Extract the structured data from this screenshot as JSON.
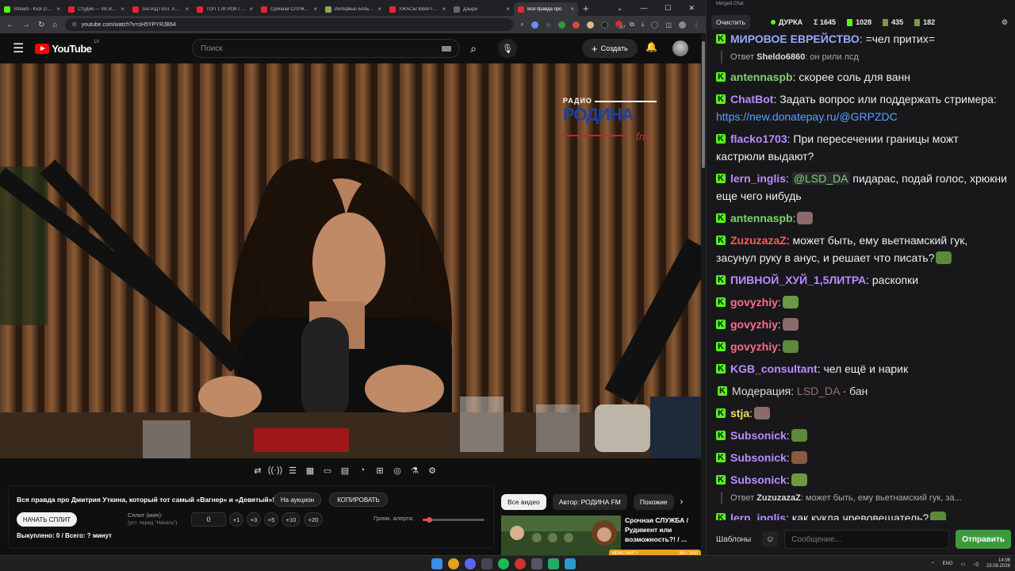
{
  "browser": {
    "tabs": [
      {
        "title": "Stream - Kick Dashboard",
        "color": "#53fc18",
        "active": false
      },
      {
        "title": "Студия — VK Видео",
        "color": "#e23",
        "active": false
      },
      {
        "title": "ЗАПАД ПАЛ. АСИМ",
        "color": "#e23",
        "active": false
      },
      {
        "title": "ТОП 1 ИГРОК ГЕНШИН",
        "color": "#e23",
        "active": false
      },
      {
        "title": "Срочная СЛУЖБА",
        "color": "#e23",
        "active": false
      },
      {
        "title": "Интервью Большое",
        "color": "#8a5",
        "active": false
      },
      {
        "title": "УЖАСЫ КВАРТИР",
        "color": "#e23",
        "active": false
      },
      {
        "title": "Дзыра",
        "color": "#666",
        "active": false
      },
      {
        "title": "Вся правда про",
        "color": "#e23",
        "active": true
      }
    ],
    "url": "youtube.com/watch?v=sH5YPYRJB64",
    "ext_badge": "357"
  },
  "youtube": {
    "logo": "YouTube",
    "country": "LV",
    "search_placeholder": "Поиск",
    "create_label": "Создать",
    "video_overlay": {
      "top": "РАДИО",
      "main": "РОДИНА",
      "fm": "fm"
    }
  },
  "panel": {
    "title": "Вся правда про Дмитрия Уткина, который тот самый «Вагнер» и «Девятый»!",
    "auction_label": "На аукцион",
    "copy_label": "КОПИРОВАТЬ",
    "start_split_label": "НАЧАТЬ СПЛИТ",
    "split_label": "Сплит (мин):",
    "split_sub": "(уст. перед \"Начать\")",
    "split_value": "0",
    "steps": [
      "+1",
      "+3",
      "+5",
      "+10",
      "+20"
    ],
    "volume_label": "Громк. алерта:",
    "volume_fraction": 0.1,
    "bought_label": "Выкуплено: 0 / Всего: ? минут"
  },
  "reco": {
    "tabs": [
      "Все видео",
      "Автор: РОДИНА FM",
      "Похожие"
    ],
    "title": "Срочная СЛУЖБА / Рудимент или возможность?! / ...",
    "meme_label": "MEME PARTY",
    "meme_count": "950 / 1500"
  },
  "chat": {
    "window_title": "Merged Chat",
    "clear_label": "Очистить",
    "streamer": "ДУРКА",
    "stats": [
      "Σ 1645",
      "1028",
      "435",
      "182"
    ],
    "messages": [
      {
        "user": "МИРОВОЕ ЕВРЕЙСТВО",
        "color": "#9aa8ff",
        "text": ": =чел притих="
      },
      {
        "reply_user": "Sheldo6860",
        "reply_text": ": он рили лсд"
      },
      {
        "user": "antennaspb",
        "color": "#7fd070",
        "text": ": скорее соль для ванн"
      },
      {
        "user": "ChatBot",
        "color": "#b98cff",
        "text": ": Задать вопрос или поддержать стримера: ",
        "link": "https://new.donatepay.ru/@GRPZDC"
      },
      {
        "user": "flacko1703",
        "color": "#b98cff",
        "text": ": При пересечении границы можт кастрюли выдают?"
      },
      {
        "user": "lern_inglis",
        "color": "#b98cff",
        "mention": "@LSD_DA",
        "text": " пидарас, подай голос, хрюкни еще чего нибудь"
      },
      {
        "user": "antennaspb",
        "color": "#7fd070",
        "text": ":",
        "emote": true
      },
      {
        "user": "ZuzuzazaZ",
        "color": "#ff5a5a",
        "text": ": может быть, ему вьетнамский гук, засунул руку в анус, и решает что писать?"
      },
      {
        "user": "ПИВНОЙ_ХУЙ_1,5ЛИТРА",
        "color": "#b98cff",
        "text": ": раскопки"
      },
      {
        "user": "govyzhiy",
        "color": "#ff6d8a",
        "text": ":"
      },
      {
        "user": "govyzhiy",
        "color": "#ff6d8a",
        "text": ":"
      },
      {
        "user": "govyzhiy",
        "color": "#ff6d8a",
        "text": ":"
      },
      {
        "user": "KGB_consultant",
        "color": "#b98cff",
        "text": ": чел ещё и нарик"
      },
      {
        "mod_label": "Модерация: ",
        "mod_user": "LSD_DA",
        "mod_action": " · бан"
      },
      {
        "user": "stja",
        "color": "#f0e060",
        "text": ":"
      },
      {
        "user": "Subsonick",
        "color": "#b98cff",
        "text": ":"
      },
      {
        "user": "Subsonick",
        "color": "#b98cff",
        "text": ":"
      },
      {
        "user": "Subsonick",
        "color": "#b98cff",
        "text": ":"
      },
      {
        "reply_user": "ZuzuzazaZ",
        "reply_text": ": может быть, ему вьетнамский гук, за..."
      },
      {
        "user": "lern_inglis",
        "color": "#b98cff",
        "text": ": как кукла чревовещатель?"
      }
    ],
    "templates_label": "Шаблоны",
    "input_placeholder": "Сообщение...",
    "send_label": "Отправить"
  },
  "taskbar": {
    "lang": "ENG",
    "time": "14:06",
    "date": "23.08.2026"
  }
}
